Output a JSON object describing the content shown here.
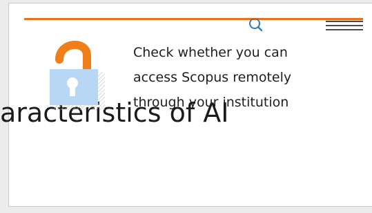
{
  "background_heading": "aracteristics of AI",
  "access_prompt": {
    "text": "Check whether you can\naccess Scopus remotely\nthrough your institution"
  },
  "icons": {
    "search": "search-icon",
    "menu": "hamburger-menu-icon",
    "lock": "open-padlock-icon"
  },
  "colors": {
    "accent": "#e9711c",
    "link": "#2e7ab5",
    "lock_body": "#b8d7f5",
    "lock_shackle": "#f07f1a"
  }
}
